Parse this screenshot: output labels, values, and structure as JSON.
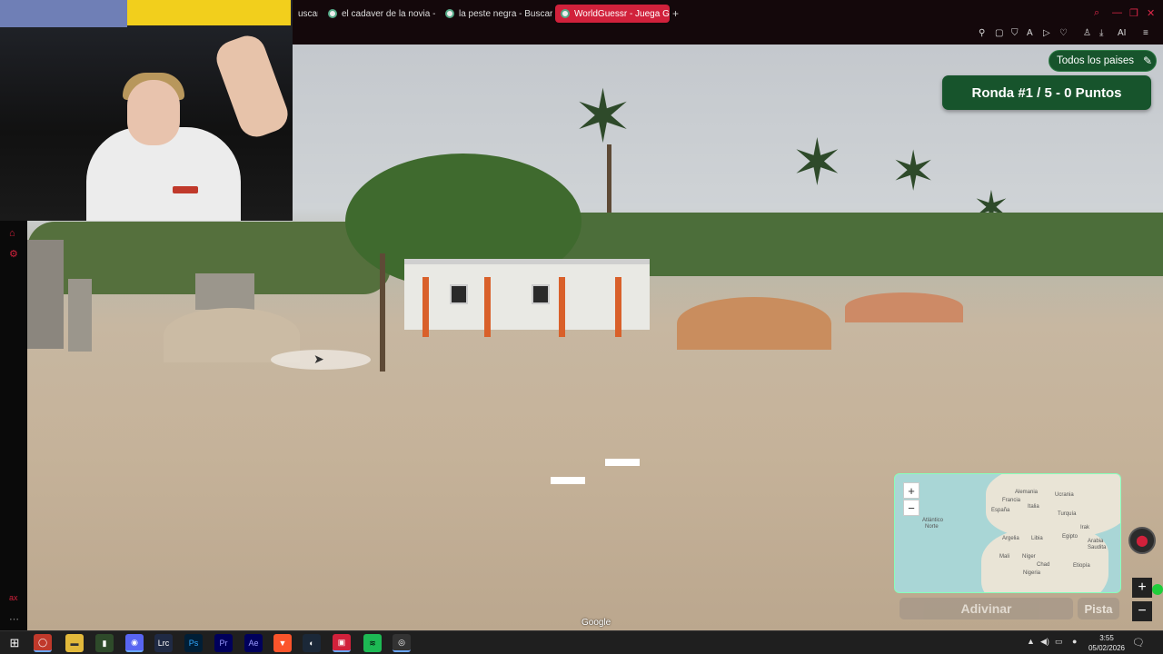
{
  "browser": {
    "tabs": [
      {
        "title": "uscar"
      },
      {
        "title": "el cadaver de la novia - Bu"
      },
      {
        "title": "la peste negra - Buscar co"
      },
      {
        "title": "WorldGuessr - Juega Geo"
      }
    ],
    "new_tab": "+",
    "toolbar_ai": "AI"
  },
  "game": {
    "country_filter": "Todos los paises",
    "round_status": "Ronda #1 / 5 - 0 Puntos",
    "guess_button": "Adivinar",
    "hint_button": "Pista",
    "map_zoom_in": "+",
    "map_zoom_out": "−",
    "street_zoom_in": "+",
    "street_zoom_out": "−",
    "map_labels": {
      "alemania": "Alemania",
      "francia": "Francia",
      "espana": "España",
      "italia": "Italia",
      "turquia": "Turquía",
      "atlantico": "Atlántico",
      "norte": "Norte",
      "argelia": "Argelia",
      "libia": "Libia",
      "egipto": "Egipto",
      "arabia": "Arabia",
      "saudita": "Saudita",
      "mali": "Mali",
      "niger": "Níger",
      "chad": "Chad",
      "nigeria": "Nigeria",
      "irak": "Irak",
      "ucrania": "Ucrania",
      "etiopia": "Etiopía"
    },
    "google": "Google"
  },
  "taskbar": {
    "clock_time": "3:55",
    "clock_date": "05/02/2026"
  }
}
